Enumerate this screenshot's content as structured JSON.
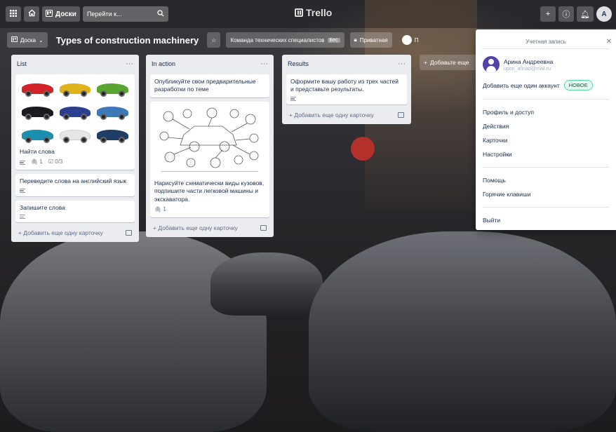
{
  "header": {
    "apps_icon": "grid-icon",
    "home_icon": "home-icon",
    "boards_label": "Доски",
    "search_placeholder": "Перейти к...",
    "logo_text": "Trello",
    "create_icon": "plus-icon",
    "info_icon": "info-icon",
    "notifications_icon": "bell-icon",
    "avatar_initials": "А"
  },
  "board": {
    "board_menu_label": "Доска",
    "title": "Types of construction machinery",
    "team_label": "Команда технических специалистов",
    "team_tag": "Бес",
    "visibility_label": "Приватная",
    "member_label": "П"
  },
  "lists": [
    {
      "title": "List",
      "cards": [
        {
          "title": "Найти слова",
          "attachments": "1",
          "checklist": "0/3"
        },
        {
          "title": "Переведите слова на английский язык"
        },
        {
          "title": "Запишите слова"
        }
      ],
      "add_card": "Добавить еще одну карточку"
    },
    {
      "title": "In action",
      "cards": [
        {
          "title": "Опубликуйте свои предварительные разработки по теме"
        },
        {
          "title": "Нарисуйте схематически виды кузовов, подпишите части легковой машины и экскаватора.",
          "attachments": "1"
        }
      ],
      "add_card": "Добавить еще одну карточку"
    },
    {
      "title": "Results",
      "cards": [
        {
          "title": "Оформите вашу работу из трех частей и представьте результаты."
        }
      ],
      "add_card": "Добавить еще одну карточку"
    }
  ],
  "add_list": "Добавьте еще",
  "account": {
    "title": "Учетная запись",
    "name": "Арина Андреевна",
    "email": "upon_arinad@mail.ru",
    "add_account": "Добавить еще один аккаунт",
    "new_badge": "НОВОЕ",
    "items_group1": [
      "Профиль и доступ",
      "Действия",
      "Карточки",
      "Настройки"
    ],
    "items_group2": [
      "Помощь",
      "Горячие клавиши"
    ],
    "logout": "Выйти"
  },
  "colors": {
    "list_bg": "#ebecf0",
    "card_bg": "#ffffff",
    "new_badge": "#e3fcef"
  }
}
